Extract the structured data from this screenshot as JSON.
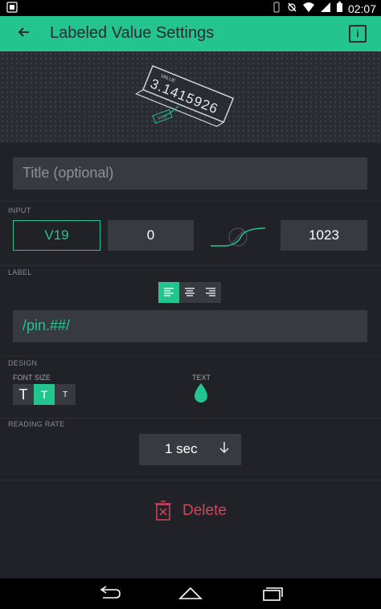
{
  "status": {
    "time": "02:07"
  },
  "appbar": {
    "title": "Labeled Value Settings",
    "info": "i"
  },
  "hero": {
    "value_text": "3.1415926",
    "small_label": "VALUE",
    "pin_text": "PIN"
  },
  "title_field": {
    "placeholder": "Title (optional)"
  },
  "input": {
    "section": "INPUT",
    "pin": "V19",
    "min": "0",
    "max": "1023"
  },
  "label": {
    "section": "LABEL",
    "value": "/pin.##/"
  },
  "design": {
    "section": "DESIGN",
    "font_size_label": "FONT SIZE",
    "text_label": "TEXT",
    "font_sizes": [
      "T",
      "T",
      "T"
    ],
    "selected_font_size_index": 1
  },
  "reading_rate": {
    "section": "READING RATE",
    "value": "1 sec"
  },
  "delete": {
    "label": "Delete"
  },
  "colors": {
    "accent": "#23c48e",
    "danger": "#d3435c",
    "bg": "#212227",
    "field": "#383a42"
  }
}
